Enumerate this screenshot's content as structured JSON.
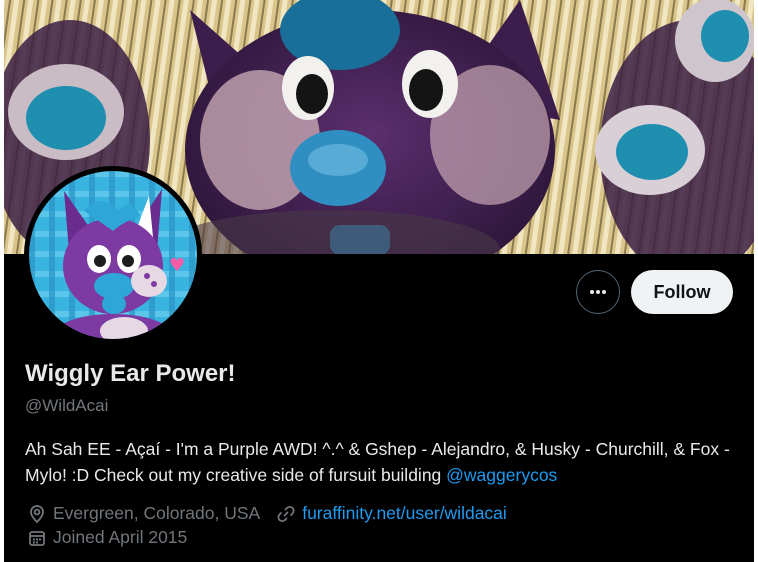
{
  "profile": {
    "display_name": "Wiggly Ear Power!",
    "handle": "@WildAcai",
    "bio_text": "Ah Sah EE - Açaí - I'm a Purple AWD! ^.^ & Gshep - Alejandro, & Husky - Churchill, & Fox - Mylo! :D  Check out my creative side of fursuit building ",
    "bio_mention": "@waggerycos",
    "location": "Evergreen, Colorado, USA",
    "website": "furaffinity.net/user/wildacai",
    "joined": "Joined April 2015"
  },
  "actions": {
    "more_icon": "more-horizontal-icon",
    "follow_label": "Follow"
  },
  "icons": {
    "location": "map-pin-icon",
    "website": "link-icon",
    "joined": "calendar-icon"
  },
  "colors": {
    "background": "#000000",
    "text": "#e7e9ea",
    "secondary_text": "#71767b",
    "link": "#1d9bf0",
    "follow_bg": "#eff3f4",
    "follow_text": "#0f1419",
    "avatar_purple": "#6a2c8e",
    "avatar_blue": "#2ea6d8"
  }
}
